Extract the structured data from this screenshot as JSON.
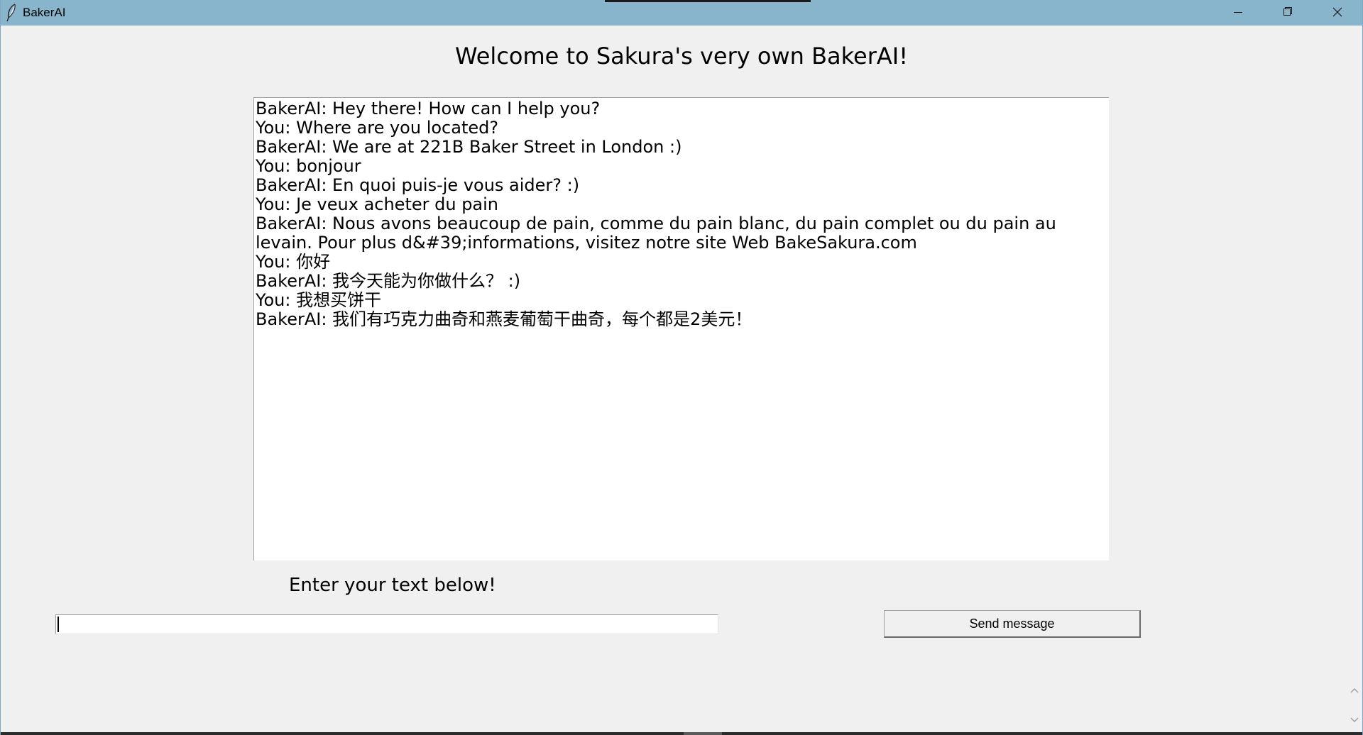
{
  "window": {
    "title": "BakerAI",
    "icon": "feather-icon",
    "controls": {
      "minimize_icon": "minimize-icon",
      "maximize_icon": "restore-icon",
      "close_icon": "close-icon"
    }
  },
  "main": {
    "welcome": "Welcome to Sakura's very own BakerAI!",
    "chat_lines": [
      "BakerAI: Hey there! How can I help you?",
      "You: Where are you located?",
      "BakerAI: We are at 221B Baker Street in London :)",
      "You: bonjour",
      "BakerAI: En quoi puis-je vous aider? :)",
      "You: Je veux acheter du pain",
      "BakerAI: Nous avons beaucoup de pain, comme du pain blanc, du pain complet ou du pain au levain. Pour plus d&#39;informations, visitez notre site Web BakeSakura.com",
      "You: 你好",
      "BakerAI: 我今天能为你做什么？ :)",
      "You: 我想买饼干",
      "BakerAI: 我们有巧克力曲奇和燕麦葡萄干曲奇，每个都是2美元！"
    ],
    "prompt_label": "Enter your text below!",
    "input": {
      "value": "",
      "placeholder": ""
    },
    "send_button_label": "Send message"
  },
  "colors": {
    "titlebar": "#88b4cc",
    "background": "#f0f0f0",
    "chat_background": "#ffffff"
  }
}
